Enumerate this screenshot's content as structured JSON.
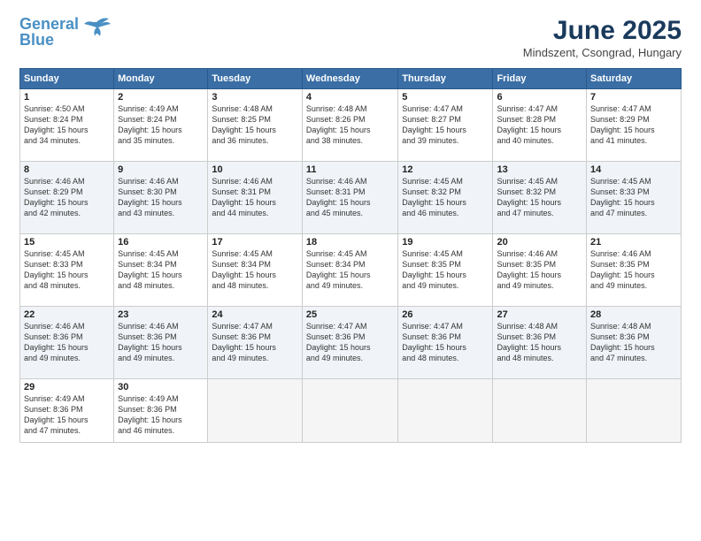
{
  "header": {
    "logo_line1": "General",
    "logo_line2": "Blue",
    "title": "June 2025",
    "subtitle": "Mindszent, Csongrad, Hungary"
  },
  "weekdays": [
    "Sunday",
    "Monday",
    "Tuesday",
    "Wednesday",
    "Thursday",
    "Friday",
    "Saturday"
  ],
  "weeks": [
    [
      {
        "day": "1",
        "info": "Sunrise: 4:50 AM\nSunset: 8:24 PM\nDaylight: 15 hours\nand 34 minutes."
      },
      {
        "day": "2",
        "info": "Sunrise: 4:49 AM\nSunset: 8:24 PM\nDaylight: 15 hours\nand 35 minutes."
      },
      {
        "day": "3",
        "info": "Sunrise: 4:48 AM\nSunset: 8:25 PM\nDaylight: 15 hours\nand 36 minutes."
      },
      {
        "day": "4",
        "info": "Sunrise: 4:48 AM\nSunset: 8:26 PM\nDaylight: 15 hours\nand 38 minutes."
      },
      {
        "day": "5",
        "info": "Sunrise: 4:47 AM\nSunset: 8:27 PM\nDaylight: 15 hours\nand 39 minutes."
      },
      {
        "day": "6",
        "info": "Sunrise: 4:47 AM\nSunset: 8:28 PM\nDaylight: 15 hours\nand 40 minutes."
      },
      {
        "day": "7",
        "info": "Sunrise: 4:47 AM\nSunset: 8:29 PM\nDaylight: 15 hours\nand 41 minutes."
      }
    ],
    [
      {
        "day": "8",
        "info": "Sunrise: 4:46 AM\nSunset: 8:29 PM\nDaylight: 15 hours\nand 42 minutes."
      },
      {
        "day": "9",
        "info": "Sunrise: 4:46 AM\nSunset: 8:30 PM\nDaylight: 15 hours\nand 43 minutes."
      },
      {
        "day": "10",
        "info": "Sunrise: 4:46 AM\nSunset: 8:31 PM\nDaylight: 15 hours\nand 44 minutes."
      },
      {
        "day": "11",
        "info": "Sunrise: 4:46 AM\nSunset: 8:31 PM\nDaylight: 15 hours\nand 45 minutes."
      },
      {
        "day": "12",
        "info": "Sunrise: 4:45 AM\nSunset: 8:32 PM\nDaylight: 15 hours\nand 46 minutes."
      },
      {
        "day": "13",
        "info": "Sunrise: 4:45 AM\nSunset: 8:32 PM\nDaylight: 15 hours\nand 47 minutes."
      },
      {
        "day": "14",
        "info": "Sunrise: 4:45 AM\nSunset: 8:33 PM\nDaylight: 15 hours\nand 47 minutes."
      }
    ],
    [
      {
        "day": "15",
        "info": "Sunrise: 4:45 AM\nSunset: 8:33 PM\nDaylight: 15 hours\nand 48 minutes."
      },
      {
        "day": "16",
        "info": "Sunrise: 4:45 AM\nSunset: 8:34 PM\nDaylight: 15 hours\nand 48 minutes."
      },
      {
        "day": "17",
        "info": "Sunrise: 4:45 AM\nSunset: 8:34 PM\nDaylight: 15 hours\nand 48 minutes."
      },
      {
        "day": "18",
        "info": "Sunrise: 4:45 AM\nSunset: 8:34 PM\nDaylight: 15 hours\nand 49 minutes."
      },
      {
        "day": "19",
        "info": "Sunrise: 4:45 AM\nSunset: 8:35 PM\nDaylight: 15 hours\nand 49 minutes."
      },
      {
        "day": "20",
        "info": "Sunrise: 4:46 AM\nSunset: 8:35 PM\nDaylight: 15 hours\nand 49 minutes."
      },
      {
        "day": "21",
        "info": "Sunrise: 4:46 AM\nSunset: 8:35 PM\nDaylight: 15 hours\nand 49 minutes."
      }
    ],
    [
      {
        "day": "22",
        "info": "Sunrise: 4:46 AM\nSunset: 8:36 PM\nDaylight: 15 hours\nand 49 minutes."
      },
      {
        "day": "23",
        "info": "Sunrise: 4:46 AM\nSunset: 8:36 PM\nDaylight: 15 hours\nand 49 minutes."
      },
      {
        "day": "24",
        "info": "Sunrise: 4:47 AM\nSunset: 8:36 PM\nDaylight: 15 hours\nand 49 minutes."
      },
      {
        "day": "25",
        "info": "Sunrise: 4:47 AM\nSunset: 8:36 PM\nDaylight: 15 hours\nand 49 minutes."
      },
      {
        "day": "26",
        "info": "Sunrise: 4:47 AM\nSunset: 8:36 PM\nDaylight: 15 hours\nand 48 minutes."
      },
      {
        "day": "27",
        "info": "Sunrise: 4:48 AM\nSunset: 8:36 PM\nDaylight: 15 hours\nand 48 minutes."
      },
      {
        "day": "28",
        "info": "Sunrise: 4:48 AM\nSunset: 8:36 PM\nDaylight: 15 hours\nand 47 minutes."
      }
    ],
    [
      {
        "day": "29",
        "info": "Sunrise: 4:49 AM\nSunset: 8:36 PM\nDaylight: 15 hours\nand 47 minutes."
      },
      {
        "day": "30",
        "info": "Sunrise: 4:49 AM\nSunset: 8:36 PM\nDaylight: 15 hours\nand 46 minutes."
      },
      {
        "day": "",
        "info": ""
      },
      {
        "day": "",
        "info": ""
      },
      {
        "day": "",
        "info": ""
      },
      {
        "day": "",
        "info": ""
      },
      {
        "day": "",
        "info": ""
      }
    ]
  ]
}
